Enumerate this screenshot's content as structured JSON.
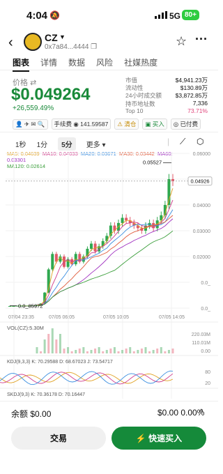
{
  "status": {
    "time": "4:04",
    "network": "5G",
    "battery": "80+"
  },
  "header": {
    "token": "CZ",
    "address": "0x7a84...4444"
  },
  "tabs": [
    "图表",
    "详情",
    "数据",
    "风险",
    "社媒热度"
  ],
  "price": {
    "label": "价格",
    "value": "$0.049264",
    "change": "+26,559.49%"
  },
  "stats": [
    {
      "k": "市值",
      "v": "$4,941.23万"
    },
    {
      "k": "流动性",
      "v": "$130.89万"
    },
    {
      "k": "24小时成交额",
      "v": "$3,872.85万"
    },
    {
      "k": "持币地址数",
      "v": "7,336"
    },
    {
      "k": "Top 10",
      "v": "73.71%"
    }
  ],
  "chips": {
    "fee_label": "手续费",
    "fee_value": "141.59587",
    "clear": "清仓",
    "buy": "买入",
    "paid": "已付费"
  },
  "timeframes": [
    "1秒",
    "1分",
    "5分",
    "更多"
  ],
  "ma": {
    "ma5": "MA5: 0.04639",
    "ma10": "MA10: 0.04033",
    "ma20": "MA20: 0.03671",
    "ma30": "MA30: 0.03442",
    "ma60": "MA60: 0.03301",
    "ma120": "MA120: 0.02614"
  },
  "chart_data": {
    "type": "candlestick",
    "y_ticks": [
      "0.06000",
      "0.05000",
      "0.04000",
      "0.03000",
      "0.02000",
      "0.0_",
      "0.0_"
    ],
    "x_ticks": [
      "07/04 23:35",
      "07/05 06:05",
      "07/05 10:05",
      "07/05 14:05"
    ],
    "high_marker": "0.05527",
    "low_marker": "0.0_85972",
    "current_price": "0.04926",
    "vol_label": "VOL(CZ):5.30M",
    "vol_ticks": [
      "220.03M",
      "110.01M",
      "0.00"
    ],
    "kdj_label": "KDJ(9,3,3) K: 70.29588  D: 68.67023  J: 73.54717",
    "kdj_ticks": [
      "80",
      "20"
    ],
    "skdj_label": "SKDJ(9,3) K: 70.36178  D: 70.16447",
    "price_series": [
      0.0008,
      0.0008,
      0.0009,
      0.0009,
      0.0008,
      0.0009,
      0.001,
      0.0012,
      0.0018,
      0.006,
      0.015,
      0.021,
      0.018,
      0.02,
      0.016,
      0.019,
      0.017,
      0.021,
      0.018,
      0.02,
      0.023,
      0.025,
      0.022,
      0.024,
      0.026,
      0.028,
      0.032,
      0.03,
      0.033,
      0.035,
      0.034,
      0.033,
      0.032,
      0.031,
      0.03,
      0.032,
      0.033,
      0.031,
      0.034,
      0.036,
      0.04,
      0.05,
      0.0493
    ]
  },
  "bottom": {
    "balance_label": "余额 $0.00",
    "balance_right": "$0.00 0.00%",
    "trade": "交易",
    "quick_buy": "快速买入"
  }
}
